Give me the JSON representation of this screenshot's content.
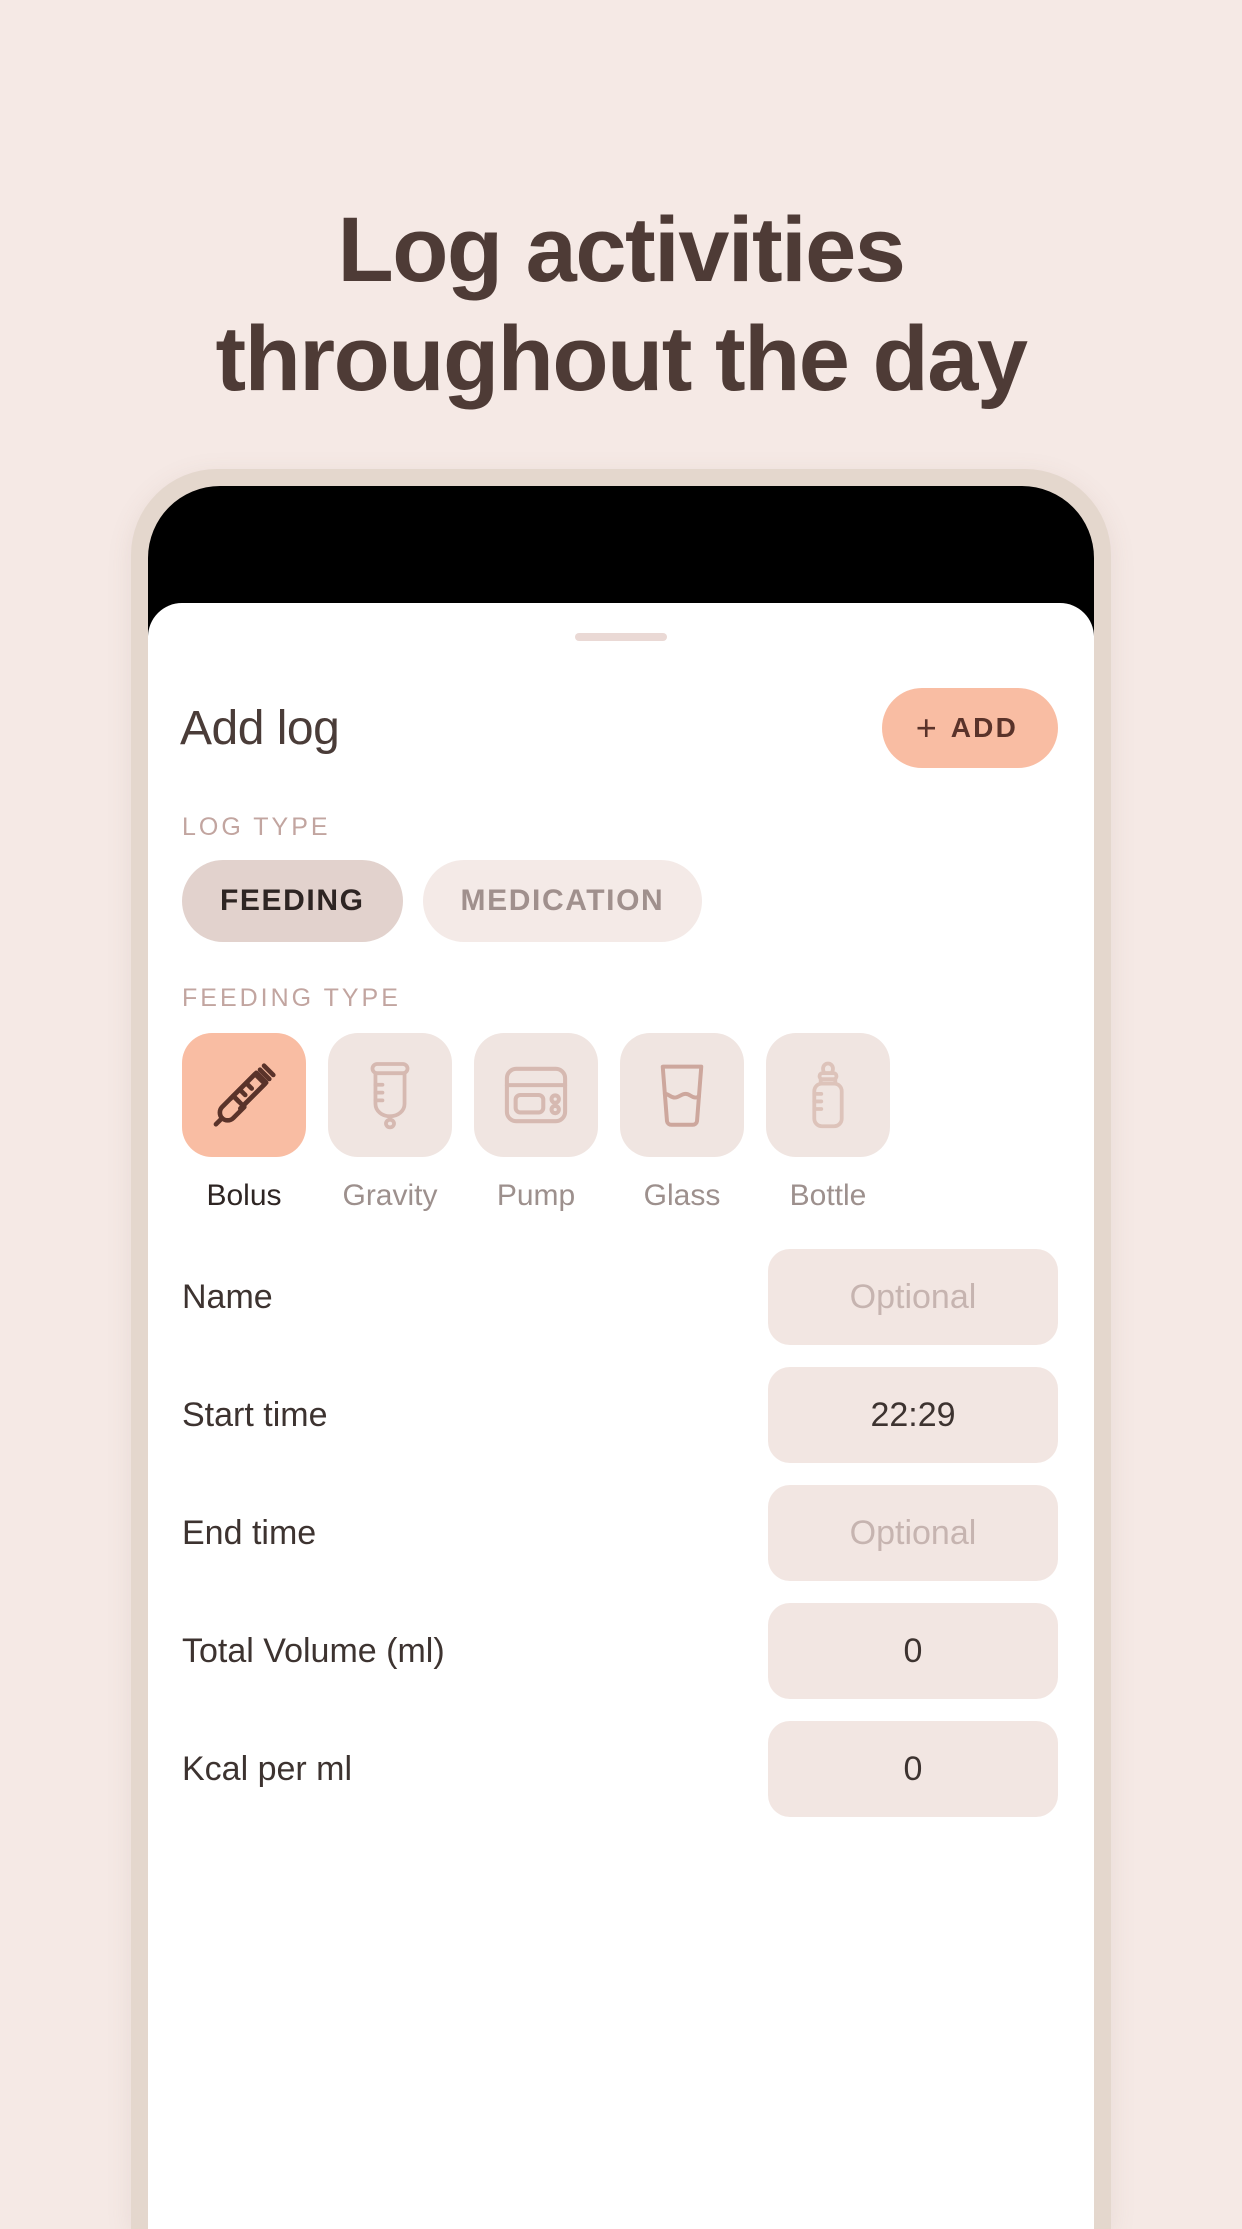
{
  "promo": {
    "headline_line1": "Log activities",
    "headline_line2": "throughout the day",
    "background_color": "#f5e9e5",
    "text_color": "#4e3b36"
  },
  "phone": {
    "bezel_color": "#e4d7cd",
    "screen_color": "#000000"
  },
  "sheet": {
    "drag_handle": "drag-handle",
    "title": "Add log",
    "add_button": {
      "plus": "+",
      "label": "ADD",
      "color": "#f9bda3",
      "text_color": "#5a332a"
    },
    "log_type": {
      "label": "LOG TYPE",
      "options": [
        {
          "label": "FEEDING",
          "selected": true
        },
        {
          "label": "MEDICATION",
          "selected": false
        }
      ]
    },
    "feeding_type": {
      "label": "FEEDING TYPE",
      "options": [
        {
          "label": "Bolus",
          "icon": "syringe-icon",
          "selected": true
        },
        {
          "label": "Gravity",
          "icon": "gravity-bag-icon",
          "selected": false
        },
        {
          "label": "Pump",
          "icon": "pump-icon",
          "selected": false
        },
        {
          "label": "Glass",
          "icon": "glass-icon",
          "selected": false
        },
        {
          "label": "Bottle",
          "icon": "baby-bottle-icon",
          "selected": false
        }
      ]
    },
    "fields": [
      {
        "label": "Name",
        "value": "Optional",
        "is_placeholder": true
      },
      {
        "label": "Start time",
        "value": "22:29",
        "is_placeholder": false
      },
      {
        "label": "End time",
        "value": "Optional",
        "is_placeholder": true
      },
      {
        "label": "Total Volume (ml)",
        "value": "0",
        "is_placeholder": false
      },
      {
        "label": "Kcal per ml",
        "value": "0",
        "is_placeholder": false
      }
    ]
  }
}
